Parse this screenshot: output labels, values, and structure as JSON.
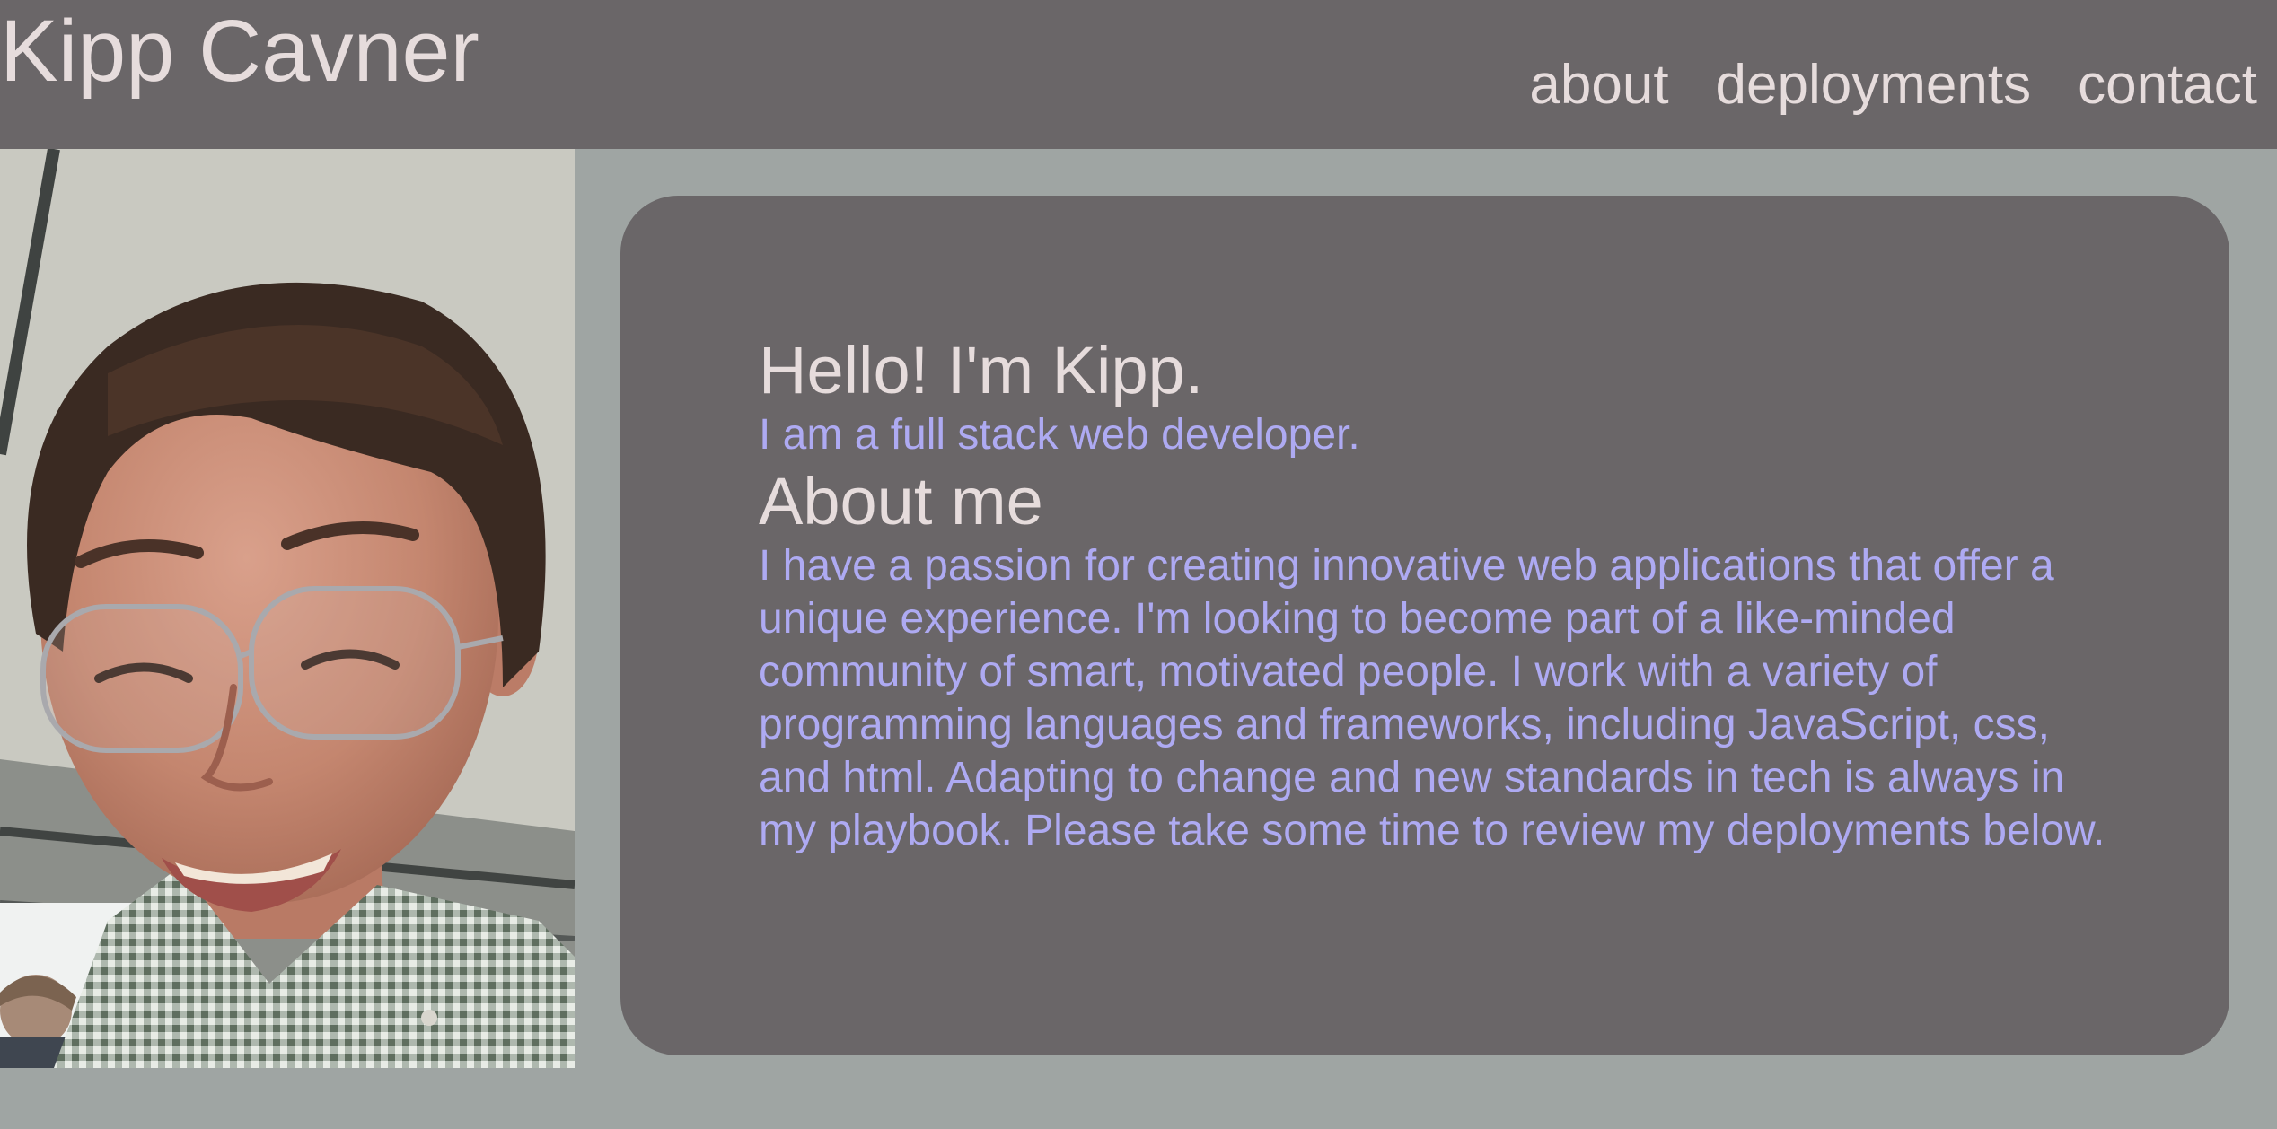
{
  "header": {
    "site_title": "Kipp Cavner",
    "nav": [
      {
        "label": "about"
      },
      {
        "label": "deployments"
      },
      {
        "label": "contact"
      }
    ]
  },
  "profile_photo": {
    "alt": "Portrait of Kipp Cavner smiling, wearing glasses and a green gingham shirt"
  },
  "intro": {
    "greeting": "Hello! I'm Kipp.",
    "role": "I am a full stack web developer."
  },
  "about": {
    "heading": "About me",
    "text": "I have a passion for creating innovative web applications that offer a unique experience. I'm looking to become part of a like-minded community of smart, motivated people. I work with a variety of programming languages and frameworks, including JavaScript, css, and html. Adapting to change and new standards in tech is always in my playbook. Please take some time to review my deployments below."
  },
  "colors": {
    "header_bg": "#6a6668",
    "page_bg": "#9fa5a3",
    "heading_text": "#e6dcdc",
    "body_text": "#aeaaf2"
  }
}
